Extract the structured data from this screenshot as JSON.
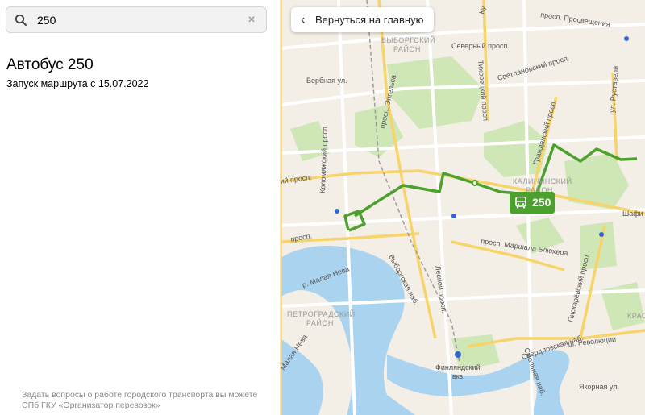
{
  "search": {
    "value": "250",
    "clear_glyph": "×"
  },
  "route": {
    "title": "Автобус 250",
    "subtitle": "Запуск маршрута с 15.07.2022"
  },
  "footer": {
    "text": "Задать вопросы о работе городского транспорта вы можете СПб ГКУ «Организатор перевозок»"
  },
  "map": {
    "back_button": "Вернуться на главную",
    "badge_number": "250",
    "route_color": "#4ca02d",
    "water_color": "#a9d3ef",
    "park_color": "#cfe6b7",
    "labels": {
      "vyborgsky_1": "ВЫБОРГСКИЙ",
      "vyborgsky_2": "РАЙОН",
      "kalininsky_1": "КАЛИНИНСКИЙ",
      "kalininsky_2": "РАЙОН",
      "petrogradsky_1": "ПЕТРОГРАДСКИЙ",
      "petrogradsky_2": "РАЙОН",
      "krasno": "КРАС",
      "verbnaya": "Вербная ул.",
      "engelsa": "просп. Энгельса",
      "kolomyazhsky": "Коломяжский просп.",
      "severny": "Северный просп.",
      "tikhoretsky": "Тихорецкий просп.",
      "svetlanovsky": "Светлановский просп.",
      "prosvescheniya": "просп. Просвещения",
      "grazhdansky": "Гражданский просп.",
      "rustaveli": "ул. Руставели",
      "shafirovsky": "Шафи",
      "blyukhera": "просп. Маршала Блюхера",
      "lesnoy": "Лесной просп.",
      "vyborgskaya_nab": "Выборгская наб.",
      "piskarevsky": "Пискарёвский просп.",
      "revolyutsii": "ш. Революции",
      "sverdlovskaya": "Свердловская наб.",
      "smolnaya": "Смольная наб.",
      "yakornaya": "Якорная ул.",
      "malaya_neva_1": "р. Малая Нева",
      "malaya_neva_2": "Малая Нева",
      "finlyandsky_1": "Финляндский",
      "finlyandsky_2": "вкз.",
      "kupchinsky_pr": "просп.",
      "prosp_left": "ий просп.",
      "ku": "Ку"
    }
  }
}
